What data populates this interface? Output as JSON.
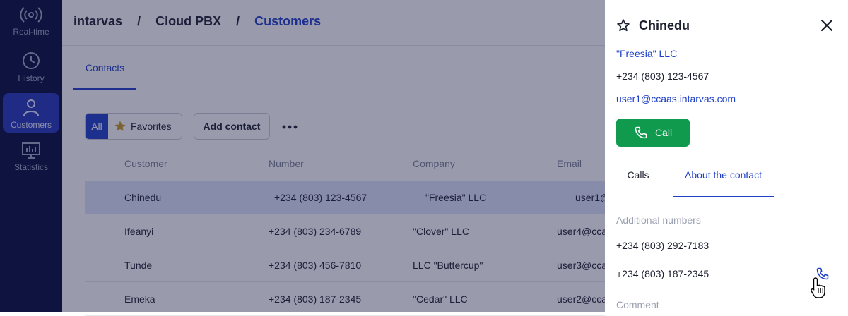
{
  "sidebar": {
    "items": [
      {
        "label": "Real-time",
        "icon": "realtime-icon"
      },
      {
        "label": "History",
        "icon": "clock-icon"
      },
      {
        "label": "Customers",
        "icon": "user-icon"
      },
      {
        "label": "Statistics",
        "icon": "chart-icon"
      }
    ],
    "active": "Customers"
  },
  "breadcrumb": {
    "items": [
      "intarvas",
      "Cloud PBX",
      "Customers"
    ],
    "separator": "/"
  },
  "tabs": {
    "contacts": "Contacts"
  },
  "filters": {
    "all": "All",
    "favorites": "Favorites"
  },
  "toolbar": {
    "add_contact": "Add contact"
  },
  "table": {
    "headers": [
      "Customer",
      "Number",
      "Company",
      "Email"
    ],
    "rows": [
      {
        "customer": "Chinedu",
        "number": "+234 (803) 123-4567",
        "company": "\"Freesia\" LLC",
        "email": "user1@"
      },
      {
        "customer": "Ifeanyi",
        "number": "+234 (803) 234-6789",
        "company": "\"Clover\" LLC",
        "email": "user4@cca"
      },
      {
        "customer": "Tunde",
        "number": "+234 (803) 456-7810",
        "company": "LLC \"Buttercup\"",
        "email": "user3@cca"
      },
      {
        "customer": "Emeka",
        "number": "+234 (803) 187-2345",
        "company": "\"Cedar\" LLC",
        "email": "user2@cca"
      }
    ]
  },
  "panel": {
    "name": "Chinedu",
    "company": "\"Freesia\" LLC",
    "phone": "+234 (803) 123-4567",
    "email": "user1@ccaas.intarvas.com",
    "call_button": "Call",
    "tabs": [
      "Calls",
      "About the contact"
    ],
    "active_tab": "About the contact",
    "additional_numbers_label": "Additional numbers",
    "additional_numbers": [
      "+234 (803) 292-7183",
      "+234 (803) 187-2345"
    ],
    "comment_label": "Comment"
  },
  "colors": {
    "accent": "#1e3fc7",
    "sidebar_bg": "#050a3a",
    "call_green": "#0f9a4d"
  }
}
